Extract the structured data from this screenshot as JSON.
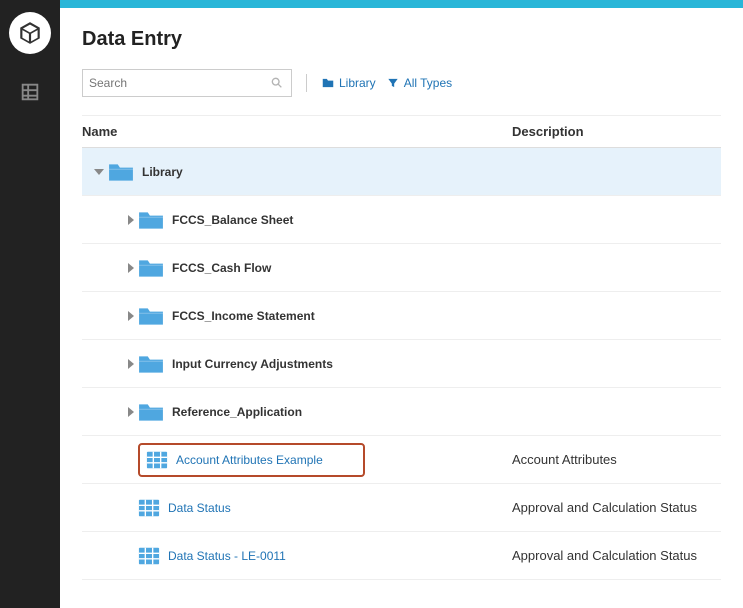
{
  "page": {
    "title": "Data Entry"
  },
  "toolbar": {
    "search_placeholder": "Search",
    "breadcrumb_label": "Library",
    "filter_label": "All Types"
  },
  "columns": {
    "name": "Name",
    "description": "Description"
  },
  "rows": [
    {
      "type": "folder",
      "indent": 0,
      "expanded": true,
      "selected": true,
      "label": "Library",
      "description": ""
    },
    {
      "type": "folder",
      "indent": 1,
      "expanded": false,
      "label": "FCCS_Balance Sheet",
      "description": ""
    },
    {
      "type": "folder",
      "indent": 1,
      "expanded": false,
      "label": "FCCS_Cash Flow",
      "description": ""
    },
    {
      "type": "folder",
      "indent": 1,
      "expanded": false,
      "label": "FCCS_Income Statement",
      "description": ""
    },
    {
      "type": "folder",
      "indent": 1,
      "expanded": false,
      "label": "Input Currency Adjustments",
      "description": ""
    },
    {
      "type": "folder",
      "indent": 1,
      "expanded": false,
      "label": "Reference_Application",
      "description": ""
    },
    {
      "type": "form",
      "indent": 1,
      "highlight": true,
      "label": "Account Attributes Example",
      "description": "Account Attributes"
    },
    {
      "type": "form",
      "indent": 1,
      "label": "Data Status",
      "description": "Approval and Calculation Status"
    },
    {
      "type": "form",
      "indent": 1,
      "label": "Data Status - LE-0011",
      "description": "Approval and Calculation Status"
    }
  ],
  "colors": {
    "folder": "#4fa7e0",
    "form": "#4fa7e0",
    "accent": "#29b6d8",
    "link": "#2074b5"
  }
}
